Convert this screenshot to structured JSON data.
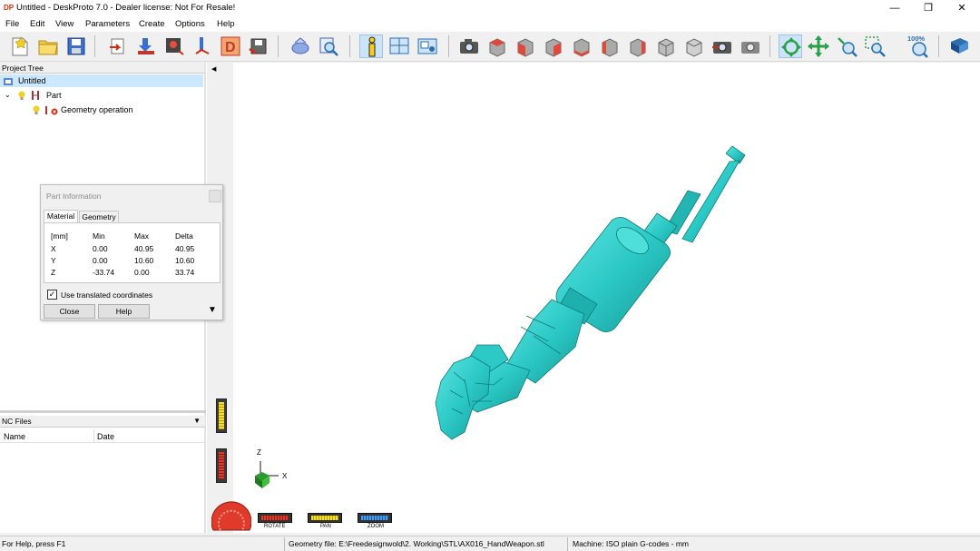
{
  "window": {
    "title": "Untitled - DeskProto 7.0 - Dealer license: Not For Resale!",
    "minimize": "—",
    "restore": "❐",
    "close": "✕"
  },
  "menu": [
    "File",
    "Edit",
    "View",
    "Parameters",
    "Create",
    "Options",
    "Help"
  ],
  "toolbar": {
    "zoom_label": "100%"
  },
  "project_tree": {
    "header": "Project Tree",
    "root": "Untitled",
    "part": "Part",
    "operation": "Geometry operation"
  },
  "nc_files": {
    "header": "NC Files",
    "col_name": "Name",
    "col_date": "Date"
  },
  "part_info": {
    "title": "Part Information",
    "tab_material": "Material",
    "tab_geometry": "Geometry",
    "headers": [
      "[mm]",
      "Min",
      "Max",
      "Delta"
    ],
    "rows": [
      [
        "X",
        "0.00",
        "40.95",
        "40.95"
      ],
      [
        "Y",
        "0.00",
        "10.60",
        "10.60"
      ],
      [
        "Z",
        "-33.74",
        "0.00",
        "33.74"
      ]
    ],
    "checkbox_label": "Use translated coordinates",
    "checkbox_checked": true,
    "close_label": "Close",
    "help_label": "Help"
  },
  "view_controls": {
    "rotate": "ROTATE",
    "pan": "PAN",
    "zoom": "ZOOM"
  },
  "axes": {
    "z": "Z",
    "x": "X"
  },
  "status": {
    "help": "For Help, press F1",
    "geometry": "Geometry file: E:\\Freedesignwold\\2. Working\\STL\\AX016_HandWeapon.stl",
    "machine": "Machine: ISO plain G-codes - mm"
  },
  "colors": {
    "model": "#2cc9c6",
    "model_dark": "#178f8e",
    "selection": "#cce8ff"
  }
}
